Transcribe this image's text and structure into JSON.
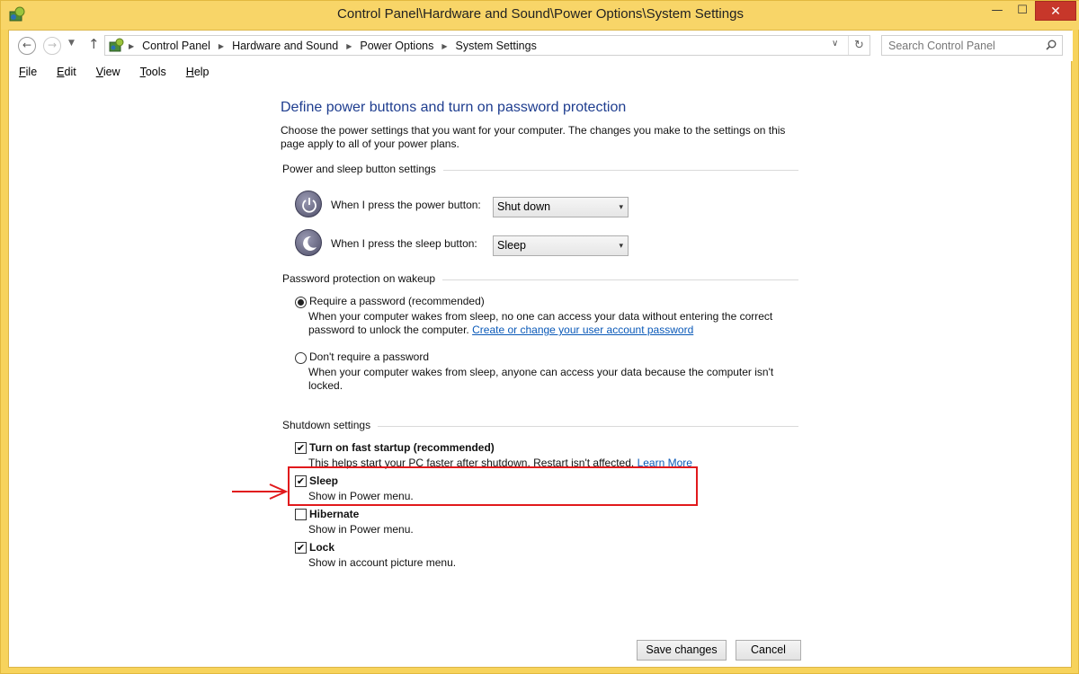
{
  "window": {
    "title": "Control Panel\\Hardware and Sound\\Power Options\\System Settings",
    "controls": {
      "minimize": "—",
      "maximize": "☐",
      "close": "✕"
    }
  },
  "nav": {
    "back_glyph": "←",
    "forward_glyph": "→",
    "recent_glyph": "▼",
    "up_glyph": "↑",
    "breadcrumbs": [
      "Control Panel",
      "Hardware and Sound",
      "Power Options",
      "System Settings"
    ],
    "crumb_separator": "▶",
    "dropdown_glyph": "∨",
    "refresh_glyph": "↻",
    "search_placeholder": "Search Control Panel"
  },
  "menu": [
    {
      "label_rest": "ile",
      "underline": "F"
    },
    {
      "label_rest": "dit",
      "underline": "E"
    },
    {
      "label_rest": "iew",
      "underline": "V"
    },
    {
      "label_rest": "ools",
      "underline": "T"
    },
    {
      "label_rest": "elp",
      "underline": "H"
    }
  ],
  "page": {
    "title": "Define power buttons and turn on password protection",
    "description": "Choose the power settings that you want for your computer. The changes you make to the settings on this page apply to all of your power plans."
  },
  "power_section": {
    "heading": "Power and sleep button settings",
    "power_label": "When I press the power button:",
    "power_value": "Shut down",
    "sleep_label": "When I press the sleep button:",
    "sleep_value": "Sleep",
    "dropdown_arrow": "▾"
  },
  "password_section": {
    "heading": "Password protection on wakeup",
    "require": {
      "label": "Require a password (recommended)",
      "desc_line1": "When your computer wakes from sleep, no one can access your data without entering the correct",
      "desc_line2_prefix": "password to unlock the computer. ",
      "link": "Create or change your user account password",
      "selected": true
    },
    "dont_require": {
      "label": "Don't require a password",
      "desc": "When your computer wakes from sleep, anyone can access your data because the computer isn't locked.",
      "selected": false
    }
  },
  "shutdown_section": {
    "heading": "Shutdown settings",
    "check_glyph": "✔",
    "items": [
      {
        "label": "Turn on fast startup (recommended)",
        "desc": "This helps start your PC faster after shutdown. Restart isn't affected. ",
        "link": "Learn More",
        "checked": true
      },
      {
        "label": "Sleep",
        "desc": "Show in Power menu.",
        "checked": true
      },
      {
        "label": "Hibernate",
        "desc": "Show in Power menu.",
        "checked": false
      },
      {
        "label": "Lock",
        "desc": "Show in account picture menu.",
        "checked": true
      }
    ]
  },
  "buttons": {
    "save": "Save changes",
    "cancel": "Cancel"
  },
  "colors": {
    "frame": "#f7d35c",
    "title_link": "#1e3d8f",
    "link": "#0a59b8",
    "annotation": "#e1191c",
    "close_button": "#c7372a"
  }
}
